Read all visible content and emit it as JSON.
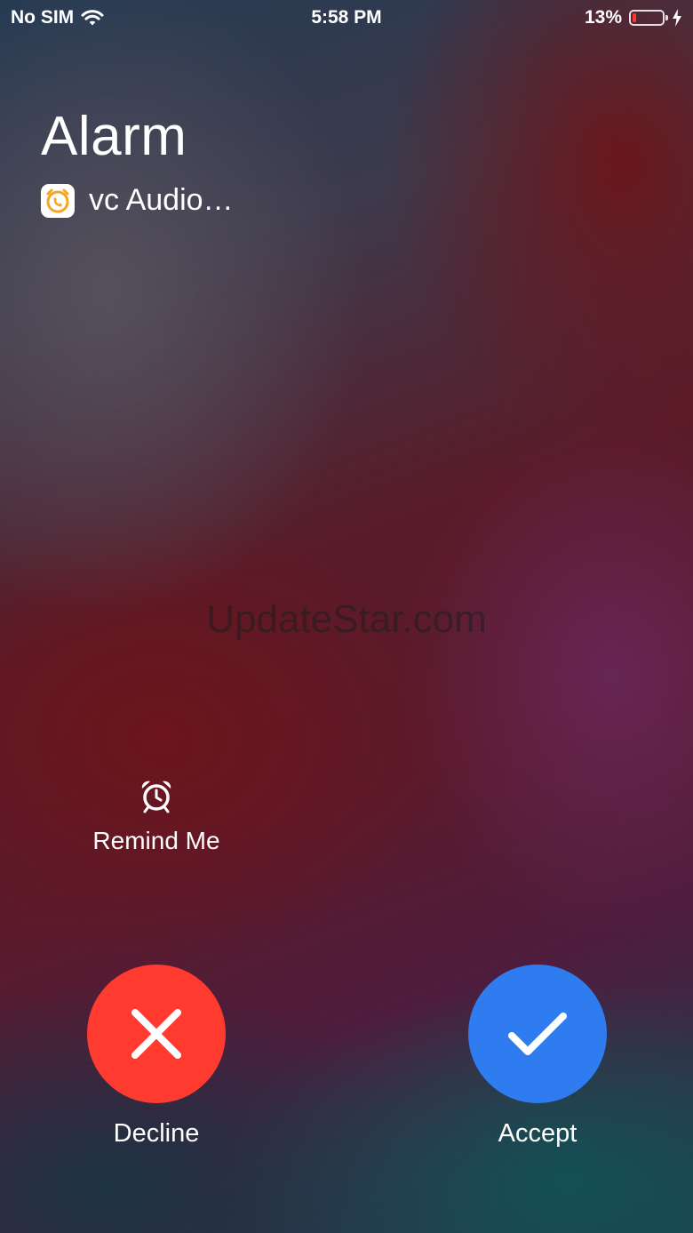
{
  "status_bar": {
    "carrier": "No SIM",
    "time": "5:58 PM",
    "battery_percent": "13%",
    "battery_level": 0.13,
    "battery_color": "#ff3b30",
    "icons": [
      "wifi-icon",
      "battery-icon",
      "charging-bolt-icon"
    ]
  },
  "call": {
    "title": "Alarm",
    "app_name": "vc Audio…",
    "app_icon": "alarm-phone-app-icon",
    "app_icon_color": "#f5a623"
  },
  "watermark": "UpdateStar.com",
  "remind": {
    "label": "Remind Me",
    "icon": "alarm-clock-icon"
  },
  "actions": {
    "decline": {
      "label": "Decline",
      "icon": "close-icon",
      "color": "#ff3b30"
    },
    "accept": {
      "label": "Accept",
      "icon": "checkmark-icon",
      "color": "#2f7cf0"
    }
  }
}
